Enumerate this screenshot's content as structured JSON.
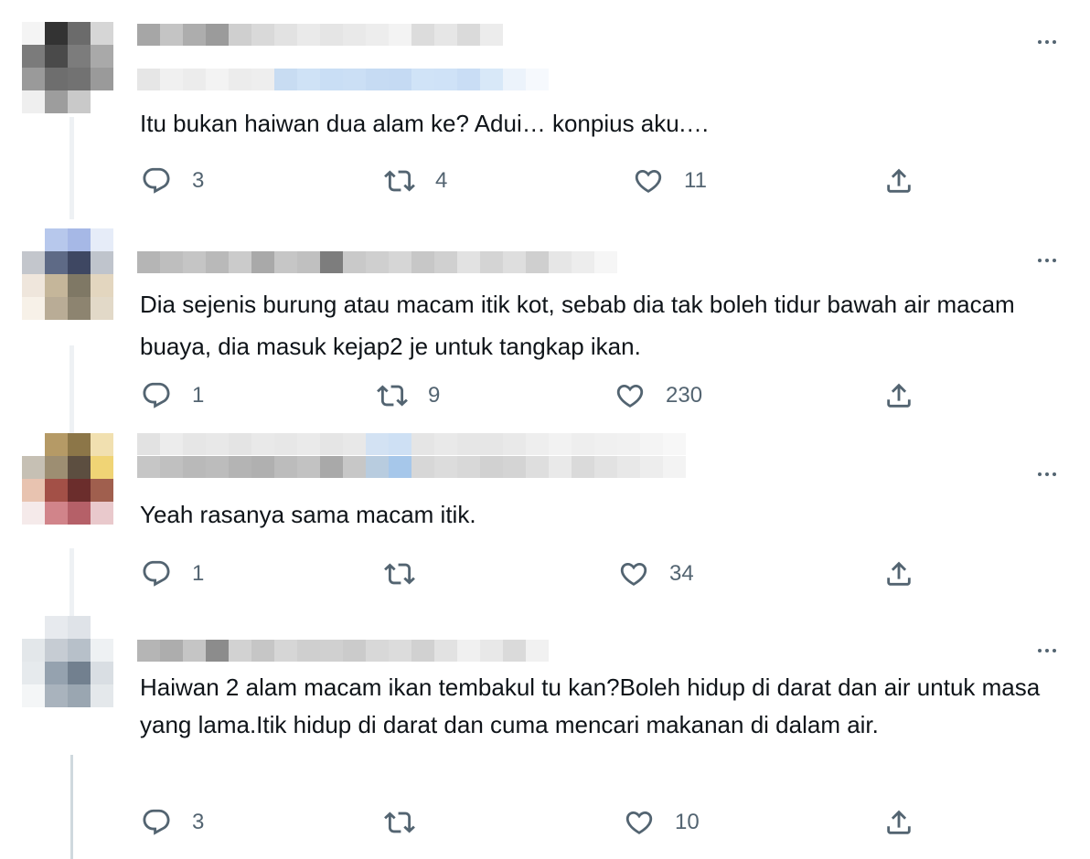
{
  "colors": {
    "text": "#0f1419",
    "secondary": "#536471",
    "thread_line": "#eef1f4"
  },
  "icons": {
    "reply": "reply-icon",
    "retweet": "retweet-icon",
    "like": "heart-icon",
    "share": "share-icon",
    "more": "more-options-icon"
  },
  "tweets": [
    {
      "text": "Itu bukan haiwan dua alam ke? Adui… konpius aku.…",
      "reply_count": "3",
      "retweet_count": "4",
      "like_count": "11",
      "avatar_colors": [
        "#f4f4f4",
        "#333333",
        "#6b6b6b",
        "#d6d6d6",
        "#7b7b7b",
        "#4a4a4a",
        "#7c7c7c",
        "#a9a9a9",
        "#9a9a9a",
        "#6e6e6e",
        "#727272",
        "#9a9a9a",
        "#efefef",
        "#9d9d9d",
        "#c9c9c9",
        "#ffffff"
      ],
      "handle_row1": [
        "#a6a6a6",
        "#c4c4c4",
        "#adadad",
        "#9b9b9b",
        "#cfcfcf",
        "#d9d9d9",
        "#e2e2e2",
        "#eaeaea",
        "#e5e5e5",
        "#e9e9e9",
        "#ededed",
        "#f3f3f3",
        "#dcdcdc",
        "#e6e6e6",
        "#dadada",
        "#ececec"
      ],
      "handle_row2": [
        "#e6e6e6",
        "#f0f0f0",
        "#ececec",
        "#f3f3f3",
        "#ececec",
        "#eeeeee",
        "#c8dcf2",
        "#cfe2f6",
        "#c9def5",
        "#cbdff5",
        "#c6dbf3",
        "#c5daf3",
        "#d0e3f7",
        "#cfe2f7",
        "#c9ddf5",
        "#d8e8f8",
        "#ecf3fb",
        "#f6f9fd",
        "#ffffff"
      ]
    },
    {
      "text": "Dia sejenis burung atau macam itik kot, sebab dia tak boleh tidur bawah air macam buaya, dia masuk kejap2 je untuk tangkap ikan.",
      "reply_count": "1",
      "retweet_count": "9",
      "like_count": "230",
      "avatar_colors": [
        "#ffffff",
        "#b7c8ec",
        "#a6b8e6",
        "#e6ecf8",
        "#c3c6cc",
        "#5e6a86",
        "#3e4762",
        "#bfc4cc",
        "#efe6dc",
        "#c5b69a",
        "#7f7865",
        "#e3d6bf",
        "#f7f1e8",
        "#b9ac96",
        "#8d8470",
        "#e2d9c8"
      ],
      "handle_row1": [
        "#b5b5b5",
        "#bebebe",
        "#c5c5c5",
        "#b9b9b9",
        "#cbcbcb",
        "#a9a9a9",
        "#c6c6c6",
        "#c0c0c0",
        "#7d7d7d",
        "#c9c9c9",
        "#cfcfcf",
        "#d6d6d6",
        "#c7c7c7",
        "#d0d0d0",
        "#e2e2e2",
        "#d4d4d4",
        "#dedede",
        "#cfcfcf",
        "#e6e6e6",
        "#ededed",
        "#f6f6f6"
      ],
      "handle_row2": []
    },
    {
      "text": "Yeah rasanya sama macam itik.",
      "reply_count": "1",
      "retweet_count": "",
      "like_count": "34",
      "avatar_colors": [
        "#ffffff",
        "#b59a66",
        "#8c7648",
        "#f1e0b0",
        "#c6c0b4",
        "#9d8e72",
        "#5c4e40",
        "#f0d475",
        "#e8c3b0",
        "#a35047",
        "#6b2d2c",
        "#a05f4e",
        "#f5eaea",
        "#d1848a",
        "#b56068",
        "#e9c9cc"
      ],
      "handle_row1": [
        "#c6c6c6",
        "#c0c0c0",
        "#b9b9b9",
        "#bcbcbc",
        "#b4b4b4",
        "#b0b0b0",
        "#bcbcbc",
        "#c2c2c2",
        "#a9a9a9",
        "#c7c7c7",
        "#b8ccdf",
        "#a6c7ea",
        "#d7d7d7",
        "#dcdcdc",
        "#d8d8d8",
        "#d1d1d1",
        "#d4d4d4",
        "#dedede",
        "#e9e9e9",
        "#dadada",
        "#e2e2e2",
        "#e8e8e8",
        "#ededed",
        "#f3f3f3"
      ],
      "handle_row2": [
        "#e2e2e2",
        "#ececec",
        "#e6e6e6",
        "#e8e8e8",
        "#e4e4e4",
        "#e9e9e9",
        "#e7e7e7",
        "#eaeaea",
        "#e5e5e5",
        "#e8e8e8",
        "#d3e2f3",
        "#cee0f4",
        "#e5e5e5",
        "#e9e9e9",
        "#e6e6e6",
        "#e6e6e6",
        "#e9e9e9",
        "#eeeeee",
        "#f2f2f2",
        "#eeeeee",
        "#f0f0f0",
        "#f1f1f1",
        "#f4f4f4",
        "#f7f7f7"
      ]
    },
    {
      "text": "Haiwan 2 alam macam ikan tembakul tu kan?Boleh hidup di darat dan air untuk masa yang lama.Itik hidup di darat dan cuma mencari makanan di dalam air.",
      "reply_count": "3",
      "retweet_count": "",
      "like_count": "10",
      "avatar_colors": [
        "#ffffff",
        "#e7eaee",
        "#dfe3e8",
        "#ffffff",
        "#e3e7ea",
        "#c6ccd3",
        "#b7c0c9",
        "#eef1f3",
        "#e6eaed",
        "#95a2af",
        "#72808f",
        "#d9dee3",
        "#f4f6f7",
        "#a9b3bd",
        "#9aa6b1",
        "#e4e8eb"
      ],
      "handle_row1": [
        "#b5b5b5",
        "#adadad",
        "#c5c5c5",
        "#8c8c8c",
        "#d2d2d2",
        "#c6c6c6",
        "#d6d6d6",
        "#cfcfcf",
        "#d0d0d0",
        "#cbcbcb",
        "#d8d8d8",
        "#dcdcdc",
        "#d1d1d1",
        "#e2e2e2",
        "#f0f0f0",
        "#e8e8e8",
        "#dadada",
        "#f1f1f1"
      ],
      "handle_row2": []
    }
  ]
}
